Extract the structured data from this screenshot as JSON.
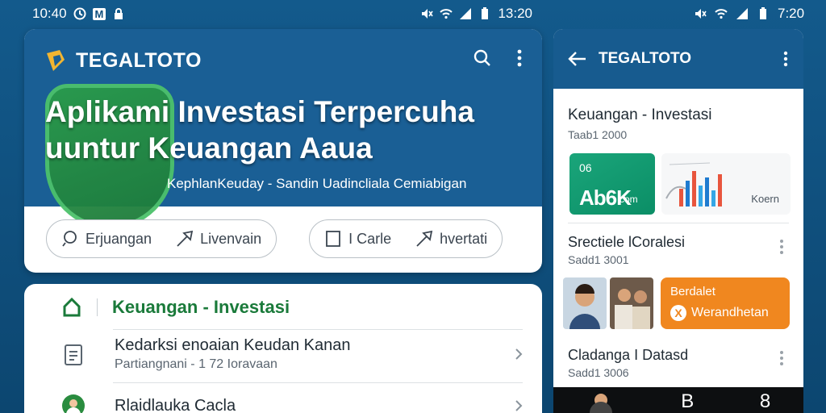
{
  "status_left": {
    "time": "10:40",
    "badge": "M",
    "right_time": "13:20"
  },
  "status_right": {
    "time": "7:20"
  },
  "hero": {
    "brand": "TEGALTOTO",
    "title": "Aplikami Investasi Terpercuha uuntur Keuangan Aaua",
    "subtitle": "KephlanKeuday - Sandin Uadincliala Cemiabigan"
  },
  "pills": [
    {
      "items": [
        {
          "label": "Erjuangan",
          "icon": "search-icon"
        },
        {
          "label": "Livenvain",
          "icon": "share-icon"
        }
      ]
    },
    {
      "items": [
        {
          "label": "I Carle",
          "icon": "document-icon"
        },
        {
          "label": "hvertati",
          "icon": "share-icon"
        }
      ]
    }
  ],
  "list": {
    "header": "Keuangan - Investasi",
    "rows": [
      {
        "title": "Kedarksi enoaian Keudan Kanan",
        "subtitle": "Partiangnani - 1 72 Ioravaan"
      },
      {
        "title": "Rlaidlauka Cacla",
        "subtitle": ""
      }
    ]
  },
  "right": {
    "appbar_title": "TEGALTOTO",
    "section_title": "Keuangan - Investasi",
    "section_sub": "Taab1 2000",
    "tile_green": {
      "top": "06",
      "big": "Ab6K",
      "small": "com"
    },
    "tile_chart_label": "Koern",
    "items": [
      {
        "title": "Srectiele lCoralesi",
        "subtitle": "Sadd1 3001"
      },
      {
        "title": "Cladanga I Datasd",
        "subtitle": "Sadd1 3006"
      }
    ],
    "promo": {
      "line1": "Berdalet",
      "line2": "Werandhetan",
      "icon_glyph": "X"
    },
    "bottom_tabs": [
      "B",
      "8"
    ]
  },
  "colors": {
    "brand_blue": "#1a5f95",
    "accent_green": "#1a7a3a",
    "promo_orange": "#f0871f"
  }
}
